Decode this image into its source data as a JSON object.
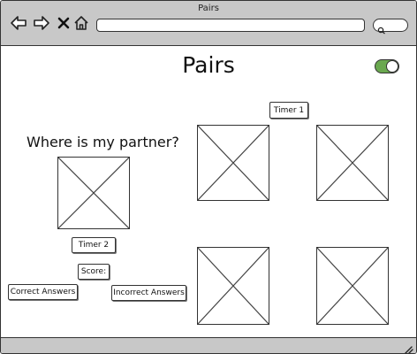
{
  "window": {
    "title": "Pairs"
  },
  "toolbar": {
    "icons": [
      "back-arrow-icon",
      "forward-arrow-icon",
      "close-icon",
      "home-icon"
    ],
    "search_icon": "search-icon"
  },
  "page": {
    "heading": "Pairs",
    "question": "Where is my partner?",
    "toggle": {
      "state": "on",
      "color": "#6aa84f"
    }
  },
  "labels": {
    "timer1": "Timer 1",
    "timer2": "Timer 2",
    "score": "Score:",
    "correct_answers": "Correct Answers",
    "incorrect_answers": "Incorrect Answers"
  },
  "colors": {
    "chrome": "#c8c8c8",
    "outline": "#333333",
    "toggle_on": "#6aa84f"
  }
}
